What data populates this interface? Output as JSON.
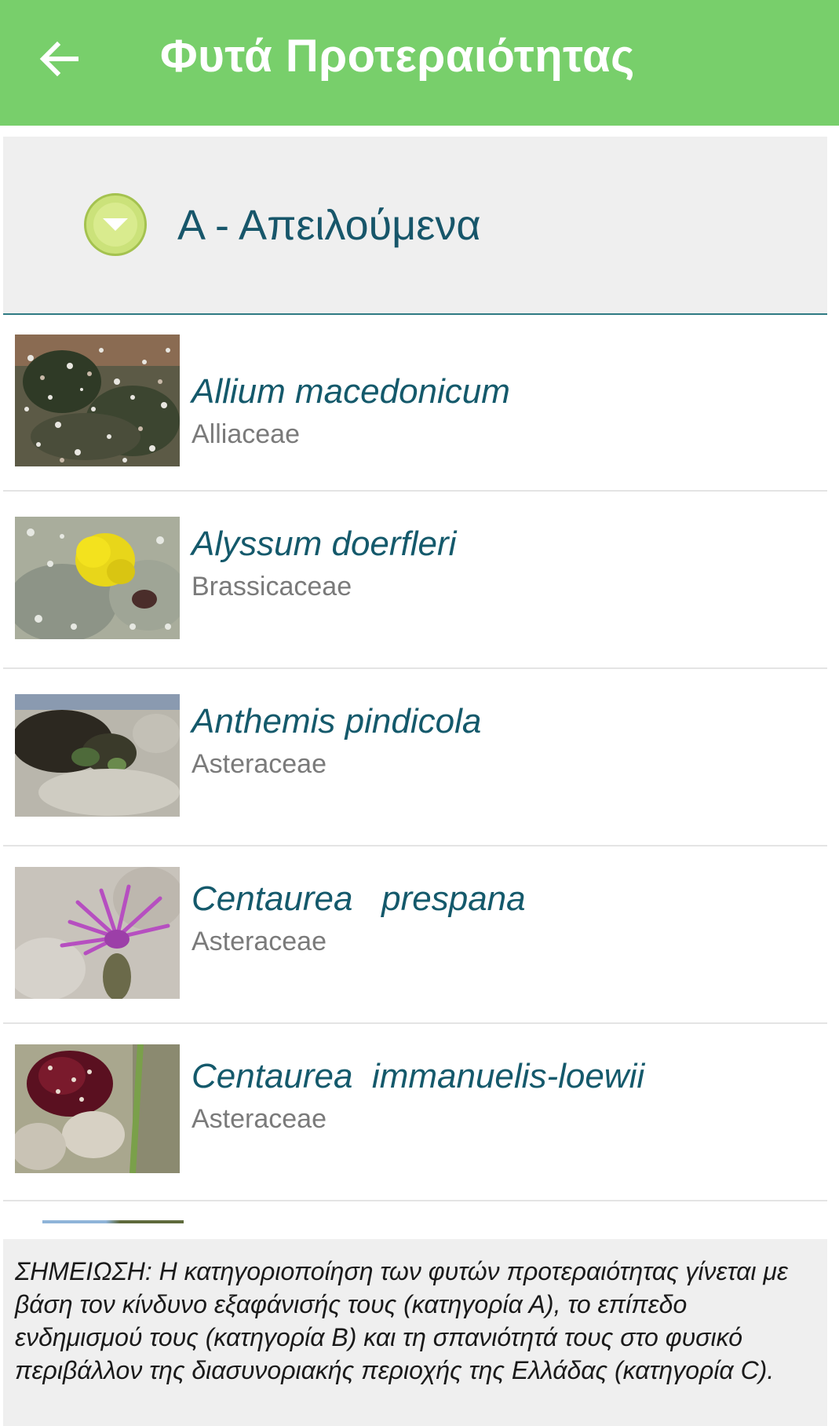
{
  "header": {
    "back_icon": "arrow-left-icon",
    "title": "Φυτά Προτεραιότητας",
    "background": "#78cf6b"
  },
  "category": {
    "title": "Α - Απειλούμενα",
    "toggle_icon": "chevron-down-icon"
  },
  "plants": [
    {
      "name": "Allium macedonicum",
      "family": "Alliaceae"
    },
    {
      "name": "Alyssum doerfleri",
      "family": "Brassicaceae"
    },
    {
      "name": "Anthemis pindicola",
      "family": "Asteraceae"
    },
    {
      "name": "Centaurea   prespana",
      "family": "Asteraceae"
    },
    {
      "name": "Centaurea  immanuelis-loewii",
      "family": "Asteraceae"
    }
  ],
  "note": {
    "text": "ΣΗΜΕΙΩΣΗ: Η κατηγοριοποίηση των φυτών προτεραιότητας γίνεται με βάση τον κίνδυνο εξαφάνισής τους (κατηγορία Α), το επίπεδο ενδημισμού τους (κατηγορία Β) και τη σπανιότητά τους στο φυσικό περιβάλλον της διασυνοριακής περιοχής της Ελλάδας (κατηγορία C)."
  },
  "colors": {
    "accent_text": "#14596b",
    "family_text": "#7a7a7a",
    "divider": "#2f7b83"
  }
}
